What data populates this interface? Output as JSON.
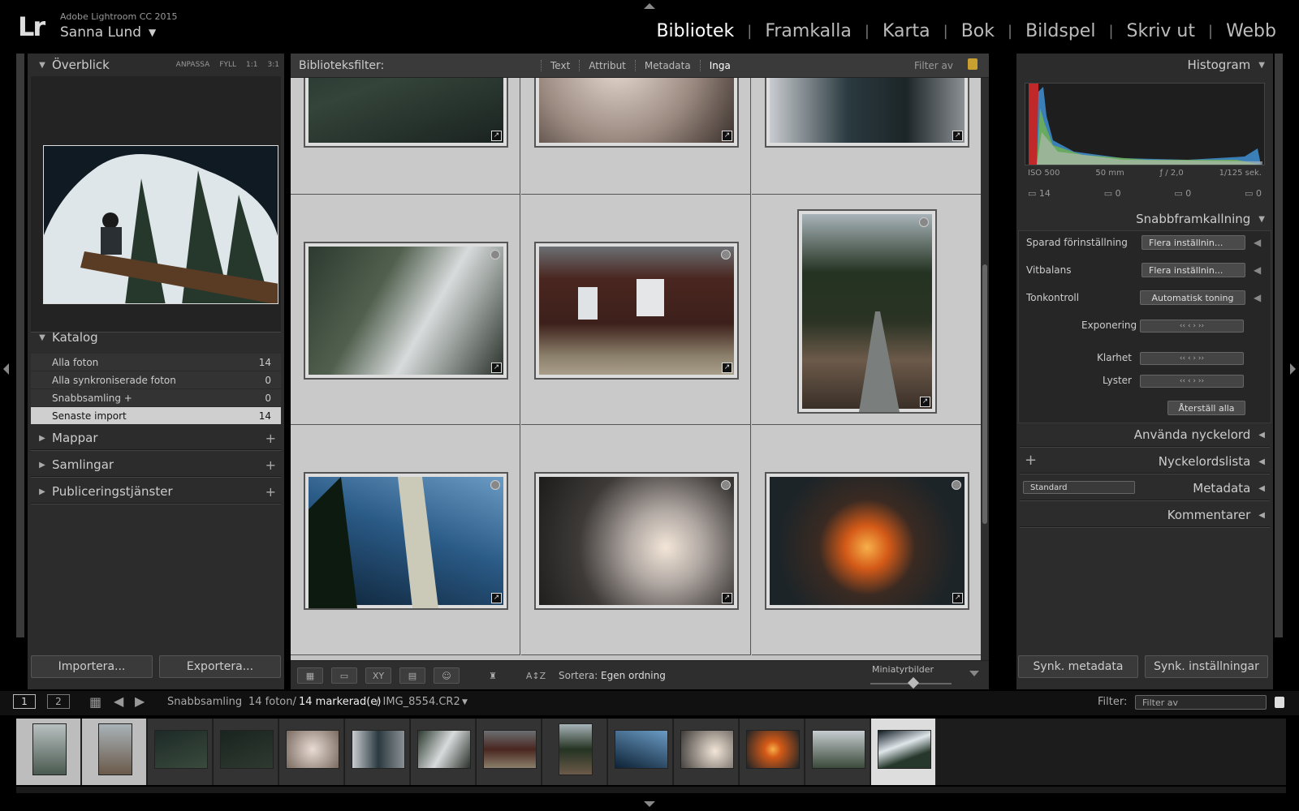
{
  "app": {
    "product": "Adobe Lightroom CC 2015",
    "logo": "Lr",
    "user": "Sanna Lund"
  },
  "modules": [
    {
      "label": "Bibliotek",
      "active": true
    },
    {
      "label": "Framkalla"
    },
    {
      "label": "Karta"
    },
    {
      "label": "Bok"
    },
    {
      "label": "Bildspel"
    },
    {
      "label": "Skriv ut"
    },
    {
      "label": "Webb"
    }
  ],
  "left": {
    "navigator": {
      "title": "Överblick",
      "options": [
        "ANPASSA",
        "FYLL",
        "1:1",
        "3:1"
      ]
    },
    "catalog": {
      "title": "Katalog",
      "items": [
        {
          "label": "Alla foton",
          "count": "14"
        },
        {
          "label": "Alla synkroniserade foton",
          "count": "0"
        },
        {
          "label": "Snabbsamling +",
          "count": "0"
        },
        {
          "label": "Senaste import",
          "count": "14",
          "selected": true
        }
      ]
    },
    "folders": "Mappar",
    "collections": "Samlingar",
    "publish": "Publiceringstjänster",
    "import_btn": "Importera...",
    "export_btn": "Exportera..."
  },
  "center": {
    "filter": {
      "label": "Biblioteksfilter:",
      "options": [
        "Text",
        "Attribut",
        "Metadata",
        "Inga"
      ],
      "active": "Inga",
      "preset": "Filter av"
    },
    "toolbar": {
      "sort_label": "Sortera:",
      "sort_value": "Egen ordning",
      "thumb_label": "Miniatyrbilder"
    }
  },
  "right": {
    "histogram": {
      "title": "Histogram",
      "iso": "ISO 500",
      "focal": "50 mm",
      "aperture": "ƒ / 2,0",
      "shutter": "1/125 sek.",
      "counts": [
        "14",
        "0",
        "0",
        "0"
      ]
    },
    "quick": {
      "title": "Snabbframkallning",
      "preset_label": "Sparad förinställning",
      "preset_value": "Flera inställnin...",
      "wb_label": "Vitbalans",
      "wb_value": "Flera inställnin...",
      "tone_label": "Tonkontroll",
      "auto_tone": "Automatisk toning",
      "exposure_label": "Exponering",
      "clarity_label": "Klarhet",
      "vibrance_label": "Lyster",
      "reset": "Återställ alla"
    },
    "keywording": "Använda nyckelord",
    "keyword_list": "Nyckelordslista",
    "metadata": "Metadata",
    "metadata_preset": "Standard",
    "comments": "Kommentarer",
    "sync_meta": "Synk. metadata",
    "sync_settings": "Synk. inställningar"
  },
  "film": {
    "page1": "1",
    "page2": "2",
    "source": "Snabbsamling",
    "count_text": "14 foton/",
    "selected_text": "14 markerad(e)",
    "file_text": "/ IMG_8554.CR2",
    "filter_label": "Filter:",
    "filter_value": "Filter av"
  },
  "colors": {
    "accent": "#ffffff",
    "panel": "#2c2c2c",
    "grid": "#c4c4c4",
    "lock": "#c8a030"
  }
}
